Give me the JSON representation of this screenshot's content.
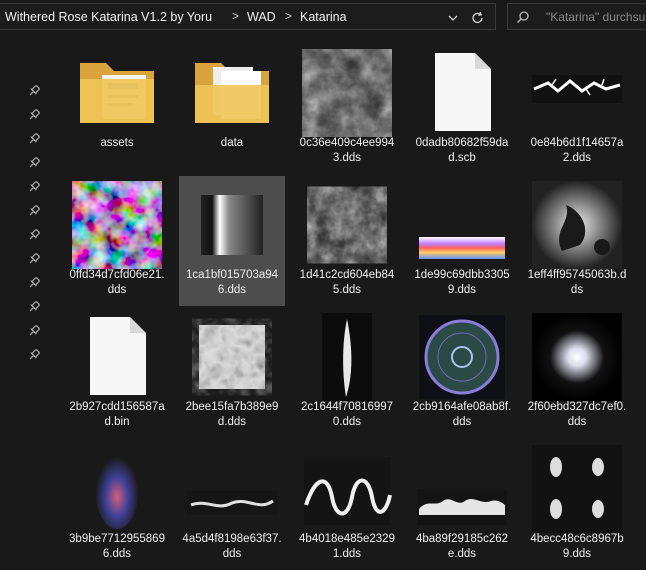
{
  "breadcrumb": {
    "items": [
      "Withered Rose Katarina V1.2 by Yoru",
      "WAD",
      "Katarina"
    ],
    "separator": ">"
  },
  "search": {
    "placeholder": "\"Katarina\" durchsu..."
  },
  "quick_access_pins": 12,
  "files": [
    {
      "name": "assets",
      "kind": "folder"
    },
    {
      "name": "data",
      "kind": "folder-docs"
    },
    {
      "name": "0c36e409c4ee9943.dds",
      "kind": "clouds"
    },
    {
      "name": "0dadb80682f59dad.scb",
      "kind": "blank-file"
    },
    {
      "name": "0e84b6d1f14657a2.dds",
      "kind": "lightning"
    },
    {
      "name": "0ffd34d7cfd06e21.dds",
      "kind": "color-noise"
    },
    {
      "name": "1ca1bf015703a946.dds",
      "kind": "gradient-bar",
      "selected": true
    },
    {
      "name": "1d41c2cd604eb845.dds",
      "kind": "clouds-small"
    },
    {
      "name": "1de99c69dbb33059.dds",
      "kind": "rainbow-strip"
    },
    {
      "name": "1eff4ff95745063b.dds",
      "kind": "smoke"
    },
    {
      "name": "2b927cdd156587ad.bin",
      "kind": "blank-file"
    },
    {
      "name": "2bee15fa7b389e9d.dds",
      "kind": "swirl"
    },
    {
      "name": "2c1644f708169970.dds",
      "kind": "slash"
    },
    {
      "name": "2cb9164afe08ab8f.dds",
      "kind": "magic-circle"
    },
    {
      "name": "2f60ebd327dc7ef0.dds",
      "kind": "glow"
    },
    {
      "name": "3b9be77129558696.dds",
      "kind": "flame"
    },
    {
      "name": "4a5d4f8198e63f37.dds",
      "kind": "wave"
    },
    {
      "name": "4b4018e485e23291.dds",
      "kind": "spiral"
    },
    {
      "name": "4ba89f29185c262e.dds",
      "kind": "splash"
    },
    {
      "name": "4becc48c6c8967b9.dds",
      "kind": "four-spots"
    }
  ],
  "colors": {
    "background": "#191919",
    "selection": "#4d4d4d",
    "folder": "#e8b84a",
    "text": "#f0f0f0"
  }
}
